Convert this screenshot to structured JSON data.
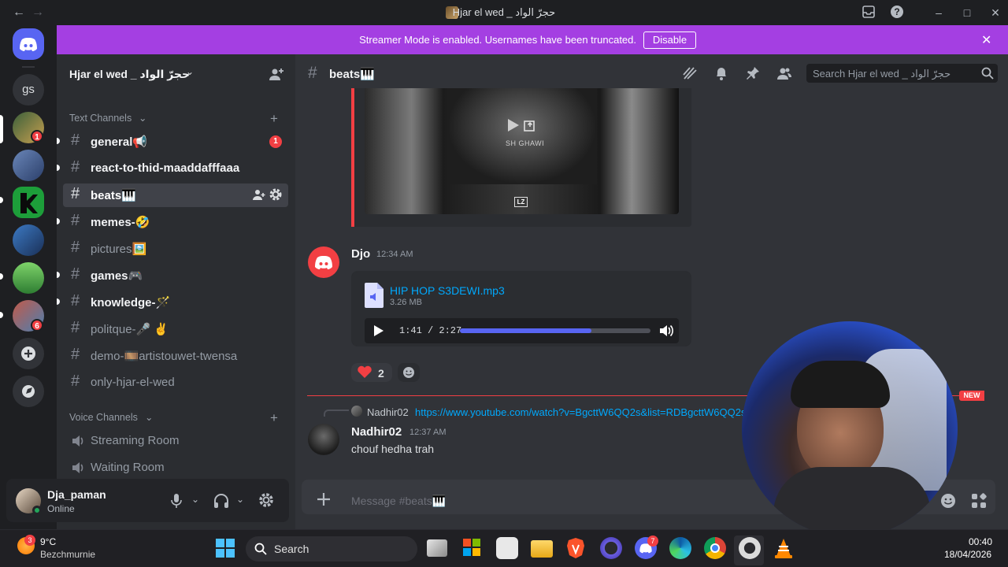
{
  "window": {
    "title": "Hjar el wed _ حجرّ الواد",
    "back": "←",
    "forward": "→"
  },
  "banner": {
    "text": "Streamer Mode is enabled. Usernames have been truncated.",
    "button": "Disable"
  },
  "rail": {
    "dm_initials": "gs",
    "badges": [
      "1",
      "6"
    ]
  },
  "server": {
    "name": "Hjar el wed _ حجرّ الواد"
  },
  "categories": {
    "text": "Text Channels",
    "voice": "Voice Channels"
  },
  "channels": [
    {
      "name": "general📢",
      "badge": "1"
    },
    {
      "name": "react-to-thid-maaddafffaaa"
    },
    {
      "name": "beats🎹"
    },
    {
      "name": "memes-🤣"
    },
    {
      "name": "pictures🖼️"
    },
    {
      "name": "games🎮"
    },
    {
      "name": "knowledge-🪄"
    },
    {
      "name": "politque-🎤 ✌️"
    },
    {
      "name": "demo-🎞️artistouwet-twensa"
    },
    {
      "name": "only-hjar-el-wed"
    }
  ],
  "voice_channels": [
    "Streaming Room",
    "Waiting Room"
  ],
  "user": {
    "name": "Dja_paman",
    "status": "Online"
  },
  "header": {
    "channel": "beats🎹",
    "search_placeholder": "Search Hjar el wed _ حجرّ الواد"
  },
  "embed": {
    "video_caption": "SH GHAWI",
    "video_tag": "LZ"
  },
  "messages": [
    {
      "author": "Djo",
      "time": "12:34 AM",
      "attachment": {
        "filename": "HIP HOP S3DEWI.mp3",
        "size": "3.26 MB",
        "position": "1:41 / 2:27",
        "progress": 0.69
      },
      "reactions": [
        {
          "emoji": "❤️",
          "count": "2"
        }
      ]
    },
    {
      "reply": {
        "author": "Nadhir02",
        "text": "https://www.youtube.com/watch?v=BgcttW6QQ2s&list=RDBgcttW6QQ2s"
      },
      "author": "Nadhir02",
      "time": "12:37 AM",
      "text": "chouf hedha trah"
    }
  ],
  "new_marker": "NEW",
  "composer": {
    "placeholder": "Message #beats🎹"
  },
  "taskbar": {
    "weather_temp": "9°C",
    "weather_place": "Bezchmurnie",
    "weather_badge": "3",
    "search": "Search",
    "time": "00:40",
    "date": "18/04/2026",
    "discord_badge": "7"
  },
  "colors": {
    "accent": "#5865f2",
    "banner": "#a43fe2",
    "danger": "#f23f43",
    "online": "#23a55a",
    "link": "#00a8fc"
  }
}
